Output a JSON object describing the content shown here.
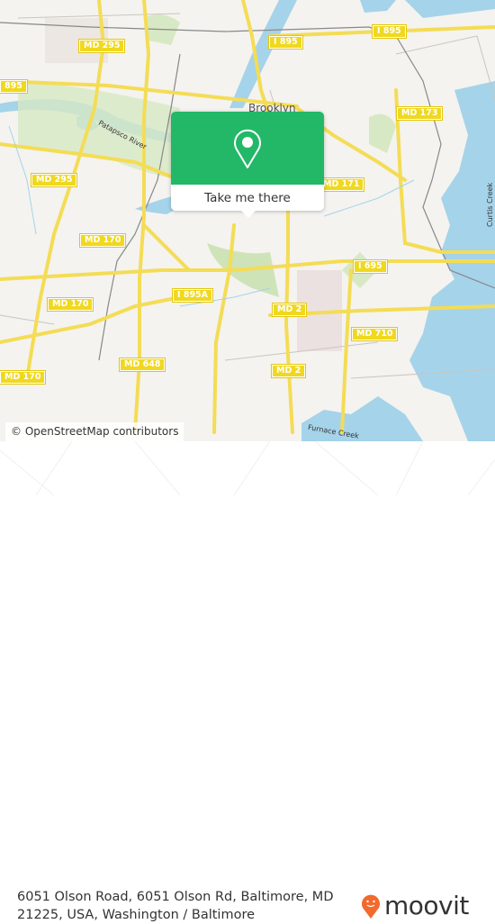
{
  "map": {
    "shields": [
      {
        "id": "md-295-top",
        "label": "MD 295"
      },
      {
        "id": "i-895-left",
        "label": "895"
      },
      {
        "id": "i-895-center",
        "label": "I 895"
      },
      {
        "id": "i-895-right",
        "label": "I 895"
      },
      {
        "id": "md-173",
        "label": "MD 173"
      },
      {
        "id": "md-295-mid",
        "label": "MD 295"
      },
      {
        "id": "md-171",
        "label": "MD 171"
      },
      {
        "id": "md-170-a",
        "label": "MD 170"
      },
      {
        "id": "md-170-b",
        "label": "MD 170"
      },
      {
        "id": "md-170-c",
        "label": "MD 170"
      },
      {
        "id": "i-895a",
        "label": "I 895A"
      },
      {
        "id": "i-695",
        "label": "I 695"
      },
      {
        "id": "md-2-a",
        "label": "MD 2"
      },
      {
        "id": "md-2-b",
        "label": "MD 2"
      },
      {
        "id": "md-710",
        "label": "MD 710"
      },
      {
        "id": "md-648",
        "label": "MD 648"
      }
    ],
    "places": {
      "brooklyn": "Brooklyn",
      "patapsco_river": "Patapsco River",
      "curtis_creek": "Curtis Creek",
      "furnace_creek": "Furnace Creek"
    },
    "attribution": "© OpenStreetMap contributors"
  },
  "popup": {
    "icon": "location-pin-icon",
    "button_label": "Take me there",
    "color": "#22b868"
  },
  "footer": {
    "address": "6051 Olson Road, 6051 Olson Rd, Baltimore, MD 21225, USA, Washington / Baltimore",
    "logo_text": "moovit",
    "logo_color": "#f26a2e"
  }
}
